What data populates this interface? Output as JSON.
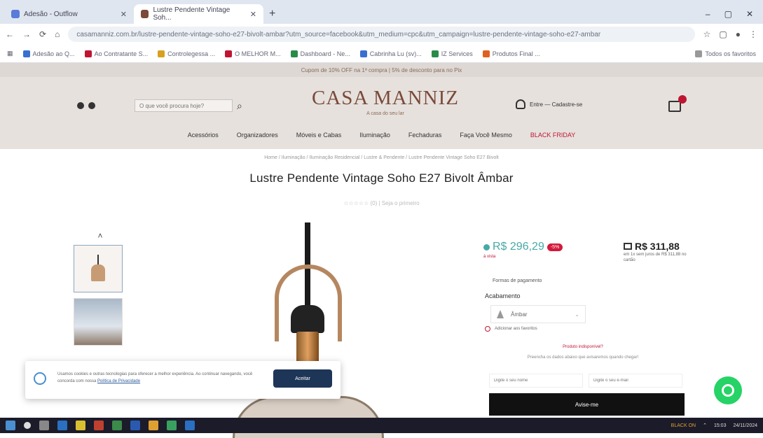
{
  "browser": {
    "tabs": [
      {
        "label": "Adesão - Outflow"
      },
      {
        "label": "Lustre Pendente Vintage Soh..."
      }
    ],
    "new_tab": "+",
    "window_controls": [
      "–",
      "▢",
      "✕"
    ],
    "url": "casamanniz.com.br/lustre-pendente-vintage-soho-e27-bivolt-ambar?utm_source=facebook&utm_medium=cpc&utm_campaign=lustre-pendente-vintage-soho-e27-ambar",
    "bookmarks": [
      {
        "label": "Adesão ao Q...",
        "color": "#3a6fd0"
      },
      {
        "label": "Ao Contratante S...",
        "color": "#c01532"
      },
      {
        "label": "Controlegessa ...",
        "color": "#d8a020"
      },
      {
        "label": "O MELHOR M...",
        "color": "#c01532"
      },
      {
        "label": "Dashboard - Ne...",
        "color": "#2a8a4a"
      },
      {
        "label": "Cabrinha Lu (sv)...",
        "color": "#3a6fd0"
      },
      {
        "label": "IZ Services",
        "color": "#2a8a4a"
      },
      {
        "label": "Produtos Final ...",
        "color": "#e06020"
      },
      {
        "label": "Todos os favoritos",
        "color": "#999999"
      }
    ]
  },
  "site": {
    "promo": "Cupom de 10% OFF na 1ª compra | 5% de desconto para no Pix",
    "search_placeholder": "O que você procura hoje?",
    "logo_name": "CASA MANNIZ",
    "logo_tagline": "A casa do seu lar",
    "account_label": "Entre — Cadastre-se",
    "nav": [
      "Acessórios",
      "Organizadores",
      "Móveis e Cabas",
      "Iluminação",
      "Fechaduras",
      "Faça Você Mesmo",
      "BLACK FRIDAY"
    ]
  },
  "product": {
    "breadcrumb": "Home / Iluminação / Iluminação Residencial / Lustre & Pendente / Lustre Pendente Vintage Soho E27 Bivolt",
    "title": "Lustre Pendente Vintage Soho E27 Bivolt Âmbar",
    "rating_text": "☆☆☆☆☆ (0) | Seja o primeiro",
    "price": "R$ 296,29",
    "discount_badge": "-5%",
    "price_note": "à vista",
    "installment_price": "R$ 311,88",
    "installment_note": "em 1x sem juros de R$ 311,88 no cartão",
    "payment_link": "Formas de pagamento",
    "finish_label": "Acabamento",
    "finish_value": "Âmbar",
    "wishlist": "Adicionar aos favoritos",
    "ship_question": "Produto indisponível?",
    "ship_sub": "Preencha os dados abaixo que avisaremos quando chegar!",
    "name_placeholder": "Digite o seu nome",
    "email_placeholder": "Digite o seu e-mail",
    "notify_button": "Avise-me"
  },
  "cookie": {
    "text": "Usamos cookies e outras tecnologias para oferecer a melhor experiência. Ao continuar navegando, você concorda com nossa",
    "link": "Política de Privacidade",
    "accept": "Aceitar"
  },
  "taskbar": {
    "tray_alert": "BLACK ON",
    "time": "15:03",
    "date": "24/11/2024"
  }
}
